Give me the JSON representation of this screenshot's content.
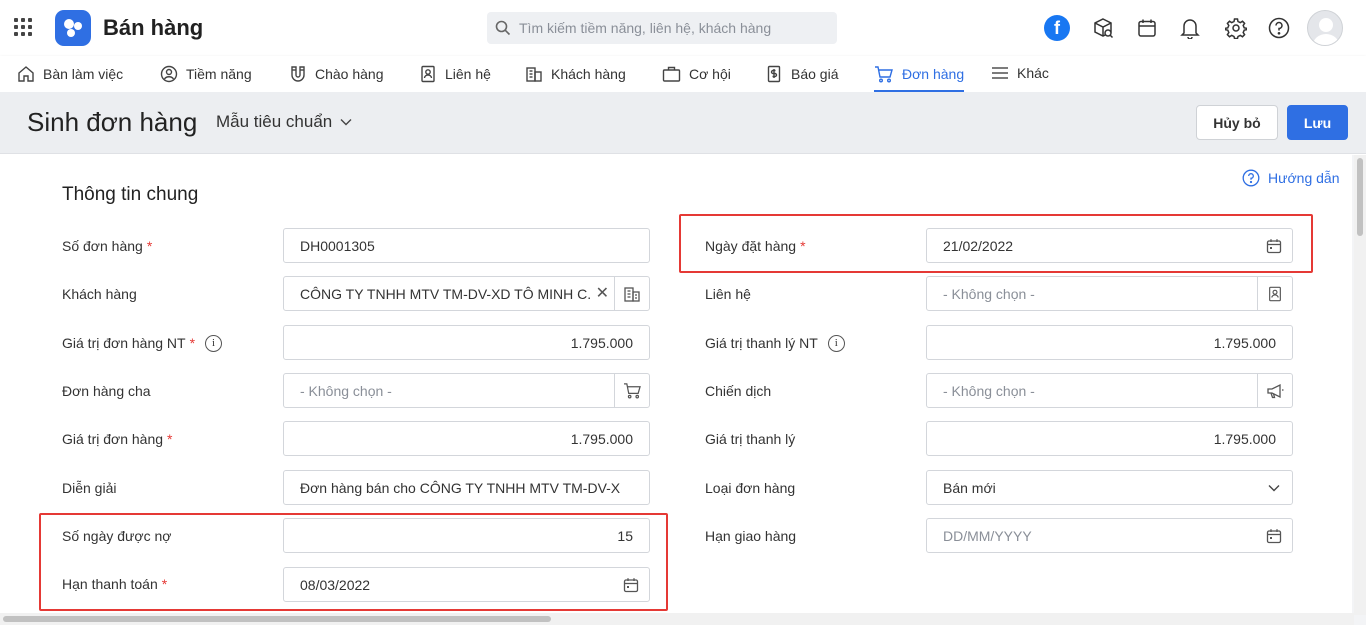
{
  "app": {
    "title": "Bán hàng"
  },
  "search": {
    "placeholder": "Tìm kiếm tiềm năng, liên hệ, khách hàng"
  },
  "topbar": {
    "facebook_label": "f"
  },
  "nav": {
    "items": [
      {
        "label": "Bàn làm việc",
        "icon": "home-icon"
      },
      {
        "label": "Tiềm năng",
        "icon": "person-icon"
      },
      {
        "label": "Chào hàng",
        "icon": "magnet-icon"
      },
      {
        "label": "Liên hệ",
        "icon": "contact-card-icon"
      },
      {
        "label": "Khách hàng",
        "icon": "building-icon"
      },
      {
        "label": "Cơ hội",
        "icon": "briefcase-icon"
      },
      {
        "label": "Báo giá",
        "icon": "quote-icon"
      },
      {
        "label": "Đơn hàng",
        "icon": "cart-icon",
        "active": true
      },
      {
        "label": "Khác",
        "icon": "menu-icon"
      }
    ]
  },
  "page": {
    "title": "Sinh đơn hàng",
    "template_label": "Mẫu tiêu chuẩn",
    "cancel_label": "Hủy bỏ",
    "save_label": "Lưu"
  },
  "section": {
    "title": "Thông tin chung",
    "guide_label": "Hướng dẫn"
  },
  "form": {
    "left": {
      "order_no": {
        "label": "Số đơn hàng",
        "value": "DH0001305"
      },
      "customer": {
        "label": "Khách hàng",
        "value": "CÔNG TY TNHH MTV TM-DV-XD TÔ MINH C..."
      },
      "order_value_nt": {
        "label": "Giá trị đơn hàng NT",
        "value": "1.795.000"
      },
      "parent_order": {
        "label": "Đơn hàng cha",
        "placeholder": "- Không chọn -"
      },
      "order_value": {
        "label": "Giá trị đơn hàng",
        "value": "1.795.000"
      },
      "description": {
        "label": "Diễn giải",
        "value": "Đơn hàng bán cho CÔNG TY TNHH MTV TM-DV-X"
      },
      "credit_days": {
        "label": "Số ngày được nợ",
        "value": "15"
      },
      "due_date": {
        "label": "Hạn thanh toán",
        "value": "08/03/2022"
      }
    },
    "right": {
      "order_date": {
        "label": "Ngày đặt hàng",
        "value": "21/02/2022"
      },
      "contact": {
        "label": "Liên hệ",
        "placeholder": "- Không chọn -"
      },
      "liquidation_nt": {
        "label": "Giá trị thanh lý NT",
        "value": "1.795.000"
      },
      "campaign": {
        "label": "Chiến dịch",
        "placeholder": "- Không chọn -"
      },
      "liquidation": {
        "label": "Giá trị thanh lý",
        "value": "1.795.000"
      },
      "order_type": {
        "label": "Loại đơn hàng",
        "value": "Bán mới"
      },
      "delivery_date": {
        "label": "Hạn giao hàng",
        "placeholder": "DD/MM/YYYY"
      }
    }
  },
  "colors": {
    "accent": "#2f6fe3",
    "highlight": "#e53935",
    "required": "#e53935"
  }
}
